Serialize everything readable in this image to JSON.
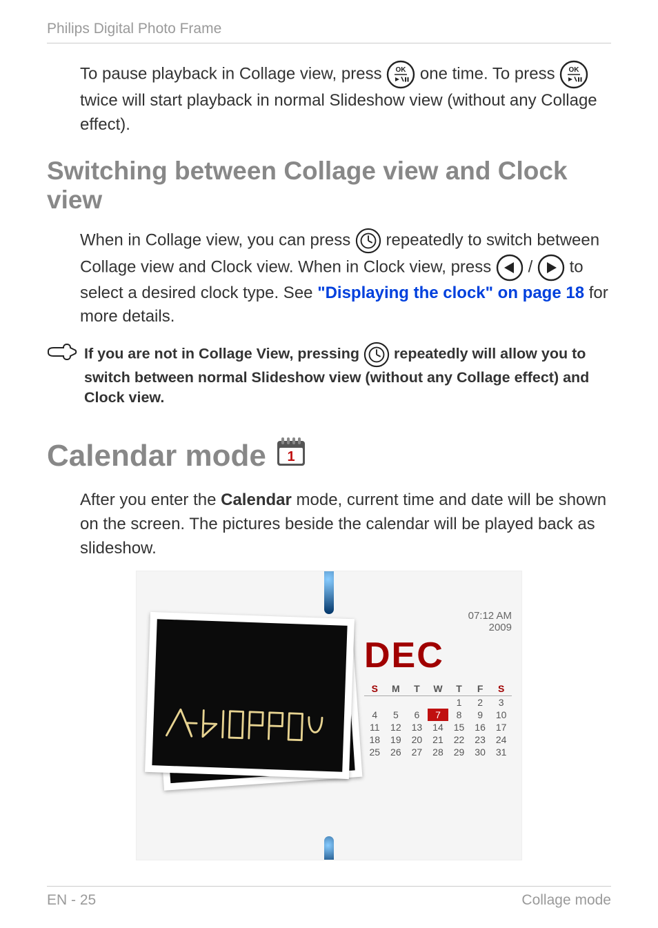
{
  "header": {
    "title": "Philips Digital Photo Frame"
  },
  "section1": {
    "p1a": "To pause playback in Collage view, press ",
    "p1b": " one time. To press ",
    "p1c": " twice will start playback in normal Slideshow view (without any Collage effect)."
  },
  "section2": {
    "heading": "Switching between Collage view and Clock view",
    "p1a": "When in Collage view, you can press ",
    "p1b": " repeatedly to switch between Collage view and Clock view. When in Clock view, press ",
    "p1c": " / ",
    "p1d": " to select a desired clock type. See ",
    "link": "\"Displaying the clock\" on page 18",
    "p1e": " for more details."
  },
  "note": {
    "t1": "If you are not in Collage View, pressing ",
    "t2": " repeatedly will allow you to switch between normal Slideshow view (without any Collage effect) and Clock view."
  },
  "section3": {
    "heading": "Calendar mode",
    "p1a": "After you enter the ",
    "bold": "Calendar",
    "p1b": " mode, current time and date will be shown on the screen. The pictures beside the calendar will be played back as slideshow."
  },
  "calendar": {
    "time": "07:12 AM",
    "year": "2009",
    "month": "DEC",
    "dow": [
      "S",
      "M",
      "T",
      "W",
      "T",
      "F",
      "S"
    ],
    "weeks": [
      [
        "",
        "",
        "",
        "",
        "1",
        "2",
        "3"
      ],
      [
        "4",
        "5",
        "6",
        "7",
        "8",
        "9",
        "10"
      ],
      [
        "11",
        "12",
        "13",
        "14",
        "15",
        "16",
        "17"
      ],
      [
        "18",
        "19",
        "20",
        "21",
        "22",
        "23",
        "24"
      ],
      [
        "25",
        "26",
        "27",
        "28",
        "29",
        "30",
        "31"
      ]
    ],
    "today": "7"
  },
  "footer": {
    "left": "EN - 25",
    "right": "Collage mode"
  }
}
